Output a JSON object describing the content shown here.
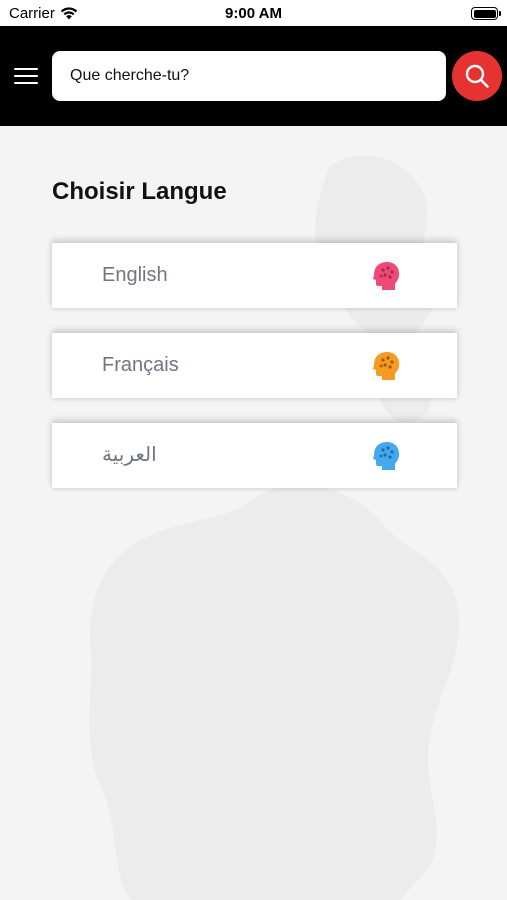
{
  "status_bar": {
    "carrier": "Carrier",
    "time": "9:00 AM"
  },
  "header": {
    "menu_icon": "hamburger-menu-icon",
    "search": {
      "placeholder": "Que cherche-tu?",
      "value": ""
    },
    "search_button_icon": "search-icon",
    "search_button_color": "#e53332"
  },
  "page": {
    "title": "Choisir Langue"
  },
  "languages": [
    {
      "label": "English",
      "icon": "head-brain-icon",
      "color": "#ef4978"
    },
    {
      "label": "Français",
      "icon": "head-brain-icon",
      "color": "#f59a23"
    },
    {
      "label": "العربية",
      "icon": "head-brain-icon",
      "color": "#45a8ef"
    }
  ]
}
